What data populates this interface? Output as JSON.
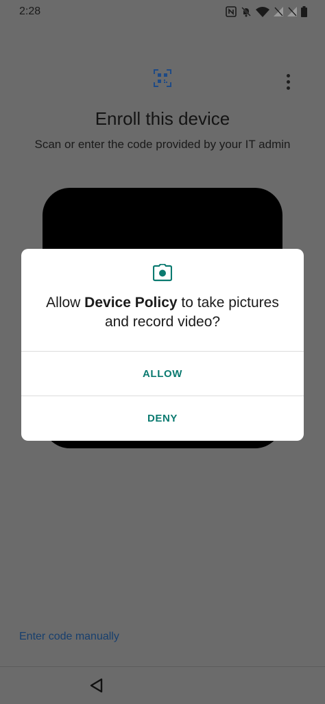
{
  "status_bar": {
    "time": "2:28",
    "icons": [
      "nfc-icon",
      "bell-off-icon",
      "wifi-icon",
      "signal-icon",
      "signal-icon",
      "battery-icon"
    ]
  },
  "header": {
    "qr_icon": "qr-code-icon",
    "menu_icon": "more-vert-icon",
    "title": "Enroll this device",
    "subtitle": "Scan or enter the code provided by your IT admin"
  },
  "footer": {
    "enter_code_label": "Enter code manually",
    "back_icon": "back-triangle-icon"
  },
  "dialog": {
    "icon": "camera-icon",
    "message_prefix": "Allow ",
    "app_name": "Device Policy",
    "message_suffix": " to take pictures and record video?",
    "allow_label": "ALLOW",
    "deny_label": "DENY"
  },
  "colors": {
    "accent": "#0b7a70",
    "link": "#173f6e",
    "scrim": "#6b6b6b"
  }
}
